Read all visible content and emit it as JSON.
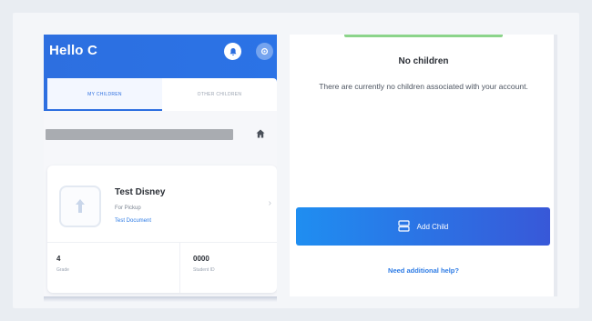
{
  "left": {
    "greeting": "Hello C",
    "tabs": [
      {
        "label": "My Children",
        "active": true
      },
      {
        "label": "Other Children",
        "active": false
      }
    ],
    "child_card": {
      "name": "Test Disney",
      "status": "For Pickup",
      "link": "Test Document",
      "stats": [
        {
          "value": "4",
          "label": "Grade"
        },
        {
          "value": "0000",
          "label": "Student ID"
        }
      ]
    }
  },
  "right": {
    "empty_title": "No children",
    "empty_desc": "There are currently no children associated with your account.",
    "add_button_label": "Add Child",
    "help_link": "Need additional help?"
  },
  "colors": {
    "primary": "#2d6fe0",
    "accent_gradient_start": "#1f8ef1",
    "accent_gradient_end": "#3858d8",
    "progress_green": "#8bd48a"
  },
  "icons": [
    "bell-icon",
    "gear-icon",
    "home-icon",
    "child-icon",
    "chevron-right-icon",
    "add-child-icon"
  ]
}
